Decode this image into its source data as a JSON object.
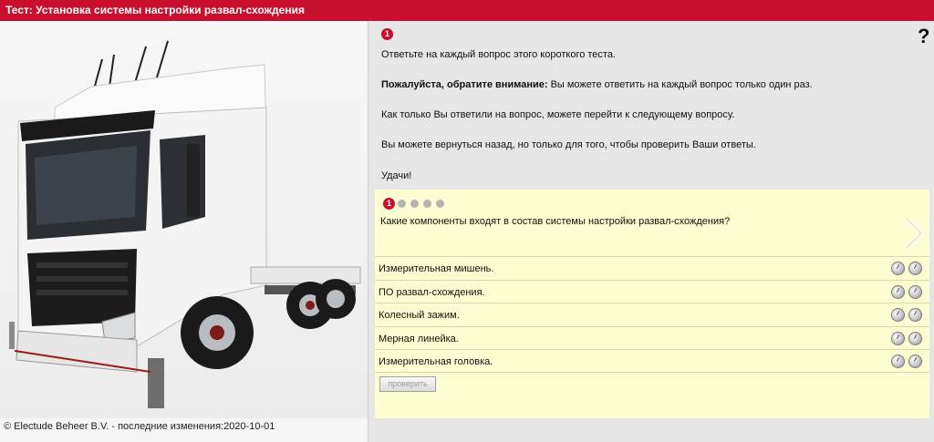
{
  "header": {
    "title": "Тест: Установка системы настройки развал-схождения"
  },
  "footer": {
    "copyright": "© Electude Beheer B.V. - последние изменения:2020-10-01"
  },
  "help": {
    "icon": "help-icon",
    "label": "?"
  },
  "intro": {
    "step_number": "1",
    "line1": "Ответьте на каждый вопрос этого короткого теста.",
    "attention_bold": "Пожалуйста, обратите внимание:",
    "attention_rest": " Вы можете ответить на каждый вопрос только один раз.",
    "line3": "Как только Вы ответили на вопрос, можете перейти к следующему вопросу.",
    "line4": "Вы можете вернуться назад, но только для того, чтобы проверить Ваши ответы.",
    "line5": "Удачи!"
  },
  "question": {
    "current_number": "1",
    "total_indicators": 5,
    "text": "Какие компоненты входят в состав системы настройки развал-схождения?",
    "answers": [
      {
        "label": "Измерительная мишень."
      },
      {
        "label": "ПО развал-схождения."
      },
      {
        "label": "Колесный зажим."
      },
      {
        "label": "Мерная линейка."
      },
      {
        "label": "Измерительная головка."
      }
    ],
    "check_button": "проверить"
  },
  "colors": {
    "brand_red": "#c8102e",
    "panel_bg": "#fdfdd2",
    "page_bg": "#e6e6e6"
  }
}
